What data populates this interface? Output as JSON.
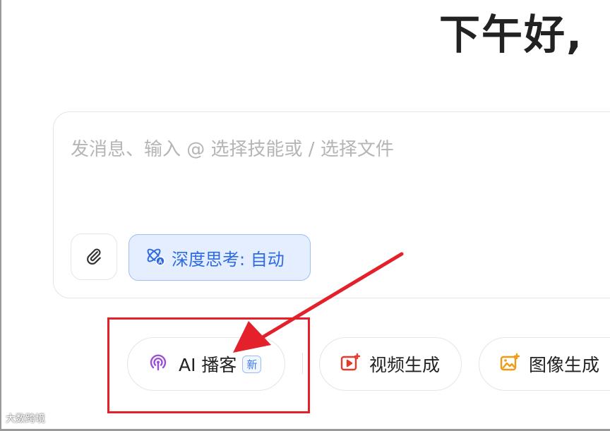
{
  "header": {
    "greeting": "下午好,"
  },
  "composer": {
    "placeholder": "发消息、输入 @ 选择技能或 / 选择文件",
    "attach_icon": "paperclip-icon",
    "deep_think_icon": "atom-icon",
    "deep_think_label": "深度思考: 自动"
  },
  "quick_actions": [
    {
      "icon": "podcast-icon",
      "label": "AI 播客",
      "badge": "新"
    },
    {
      "icon": "video-icon",
      "label": "视频生成"
    },
    {
      "icon": "image-icon",
      "label": "图像生成"
    }
  ],
  "annotation": {
    "color": "#e4202a"
  },
  "watermark": {
    "text": "大数跨境"
  },
  "colors": {
    "accent": "#2f6be0",
    "deep_think_bg": "#e4eeff",
    "annotation_red": "#e4202a"
  }
}
